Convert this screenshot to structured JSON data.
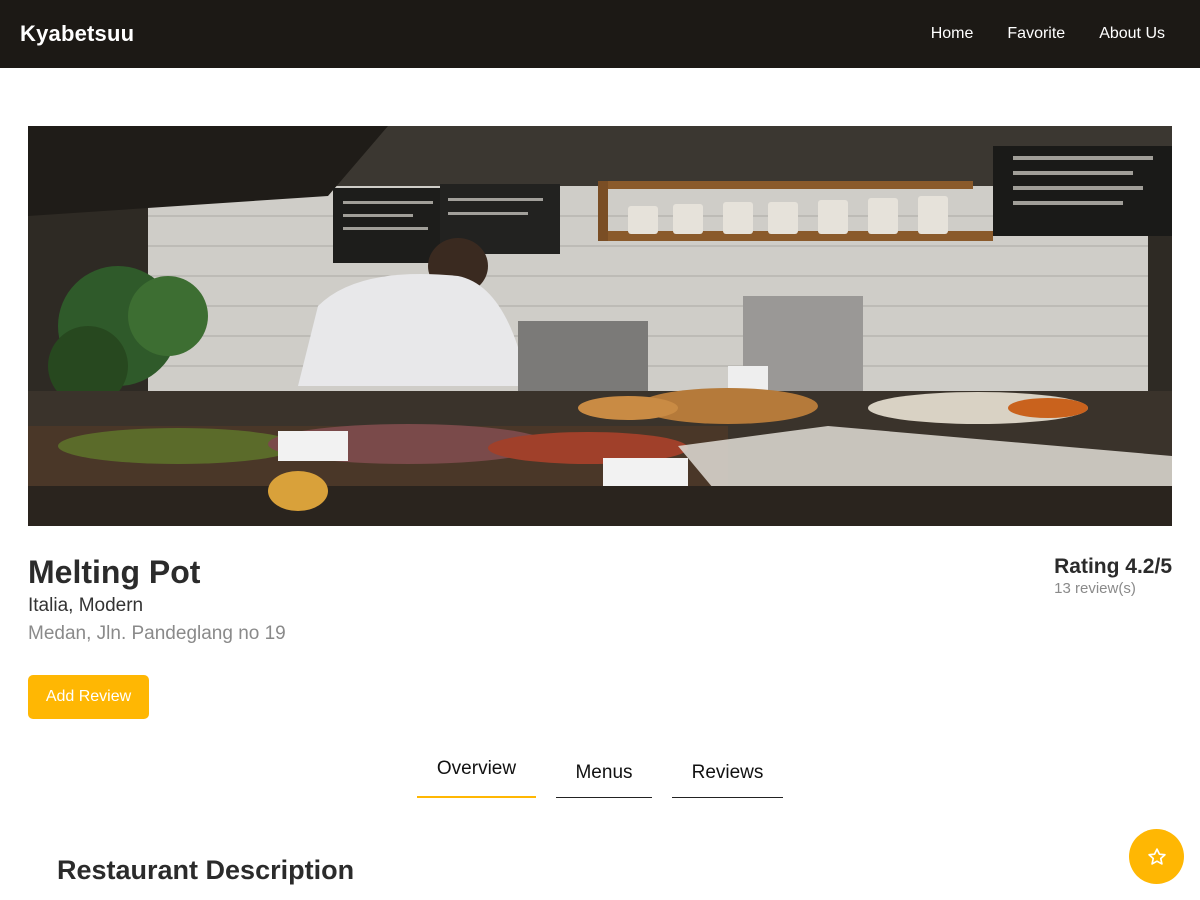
{
  "navbar": {
    "brand": "Kyabetsuu",
    "links": [
      "Home",
      "Favorite",
      "About Us"
    ]
  },
  "hero": {
    "image_description_icon": "restaurant-kitchen-photo"
  },
  "restaurant": {
    "name": "Melting Pot",
    "categories": "Italia, Modern",
    "address": "Medan, Jln. Pandeglang no 19",
    "rating_label": "Rating 4.2/5",
    "review_count": "13 review(s)"
  },
  "actions": {
    "add_review": "Add Review"
  },
  "tabs": [
    {
      "label": "Overview",
      "active": true
    },
    {
      "label": "Menus",
      "active": false
    },
    {
      "label": "Reviews",
      "active": false
    }
  ],
  "content": {
    "section_title": "Restaurant Description"
  },
  "fab": {
    "icon": "star-icon"
  },
  "colors": {
    "navbar_bg": "#1c1915",
    "accent": "#ffb703"
  }
}
